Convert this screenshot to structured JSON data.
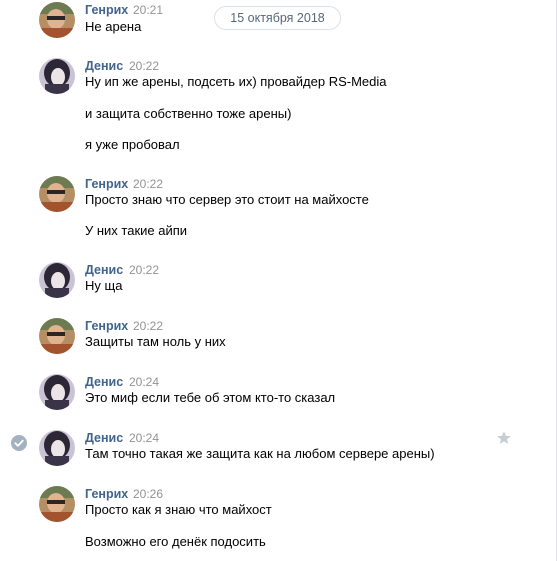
{
  "date_divider": "15 октября 2018",
  "messages": [
    {
      "author": "Генрих",
      "time": "20:21",
      "lines": [
        "Не арена"
      ]
    },
    {
      "author": "Денис",
      "time": "20:22",
      "lines": [
        "Ну ип же арены, подсеть их) провайдер RS-Media",
        "и защита собственно тоже арены)",
        "я уже пробовал"
      ]
    },
    {
      "author": "Генрих",
      "time": "20:22",
      "lines": [
        "Просто знаю что сервер это стоит на майхосте",
        "У них такие айпи"
      ]
    },
    {
      "author": "Денис",
      "time": "20:22",
      "lines": [
        "Ну ща"
      ]
    },
    {
      "author": "Генрих",
      "time": "20:22",
      "lines": [
        "Защиты там ноль у них"
      ]
    },
    {
      "author": "Денис",
      "time": "20:24",
      "lines": [
        "Это миф если тебе об этом кто-то сказал"
      ]
    },
    {
      "author": "Денис",
      "time": "20:24",
      "lines": [
        "Там точно такая же защита как на любом сервере арены)"
      ]
    },
    {
      "author": "Генрих",
      "time": "20:26",
      "lines": [
        "Просто как я знаю что майхост",
        "Возможно его денёк подосить"
      ]
    }
  ],
  "icons": {
    "selected_check": "check-circle-icon",
    "favorite": "star-icon"
  },
  "colors": {
    "author": "#42648b",
    "time": "#939393",
    "date_text": "#55677d",
    "check": "#a3b1c2",
    "star": "#c6cdd4"
  }
}
